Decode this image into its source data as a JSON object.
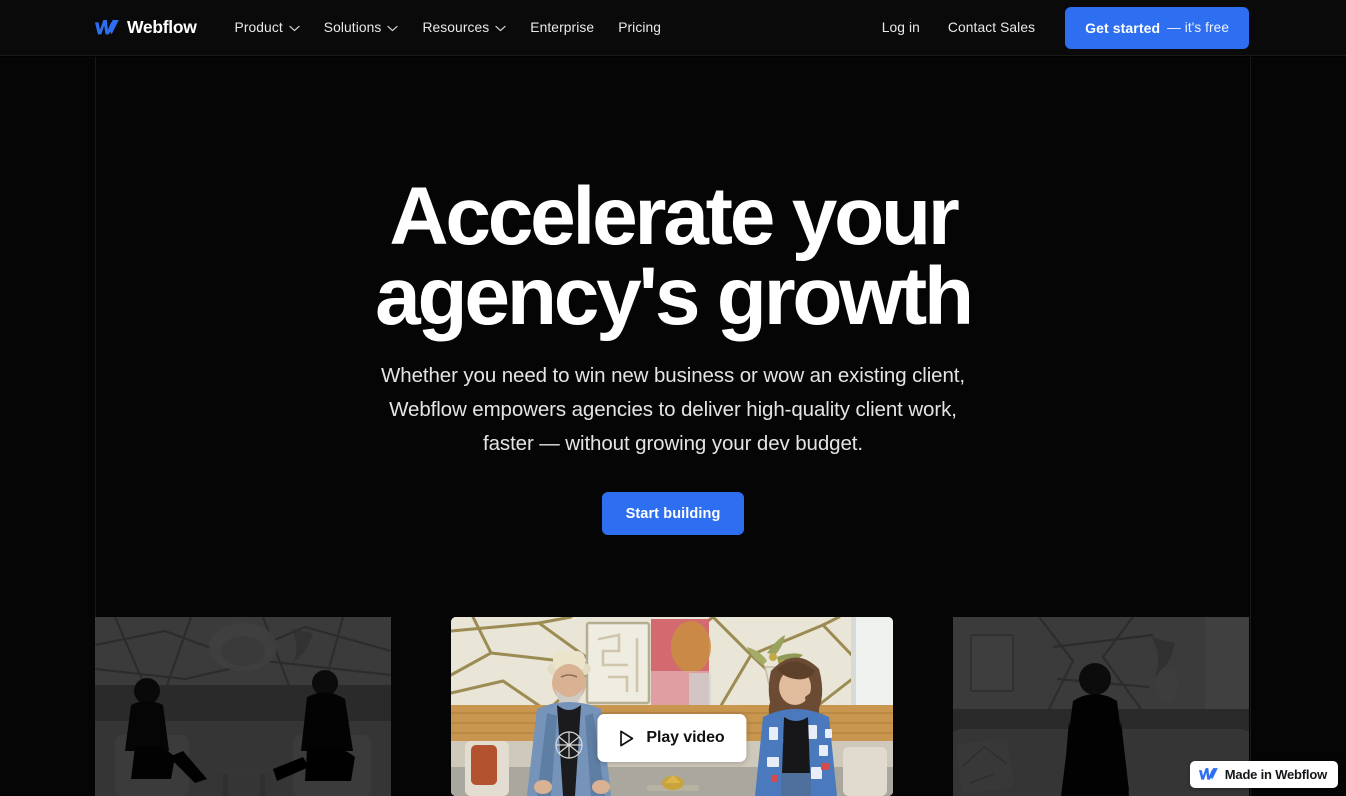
{
  "brand": {
    "name": "Webflow",
    "logo_icon": "webflow-logo-icon",
    "logo_color": "#2E6FF2"
  },
  "nav": {
    "links": [
      {
        "label": "Product",
        "has_dropdown": true,
        "icon": "chevron-down-icon"
      },
      {
        "label": "Solutions",
        "has_dropdown": true,
        "icon": "chevron-down-icon"
      },
      {
        "label": "Resources",
        "has_dropdown": true,
        "icon": "chevron-down-icon"
      },
      {
        "label": "Enterprise",
        "has_dropdown": false,
        "icon": ""
      },
      {
        "label": "Pricing",
        "has_dropdown": false,
        "icon": ""
      }
    ],
    "login_label": "Log in",
    "contact_label": "Contact Sales",
    "cta_strong": "Get started",
    "cta_light": "— it's free",
    "cta_color": "#2E6FF2"
  },
  "hero": {
    "headline": "Accelerate your\nagency's growth",
    "subheadline": "Whether you need to win new business or wow an existing client,\nWebflow empowers agencies to deliver high-quality client work,\nfaster — without growing your dev budget.",
    "cta_label": "Start building",
    "cta_color": "#2E6FF2"
  },
  "media": {
    "play_label": "Play video",
    "play_icon": "play-triangle-icon",
    "main_thumbnail_alt": "Two people seated in a bright room with a geometric patterned wall",
    "left_thumbnail_alt": "Two people seated in armchairs, darkened grayscale",
    "right_thumbnail_alt": "A person seated on a sofa, darkened grayscale"
  },
  "badge": {
    "label": "Made in Webflow",
    "icon": "webflow-logo-icon"
  }
}
